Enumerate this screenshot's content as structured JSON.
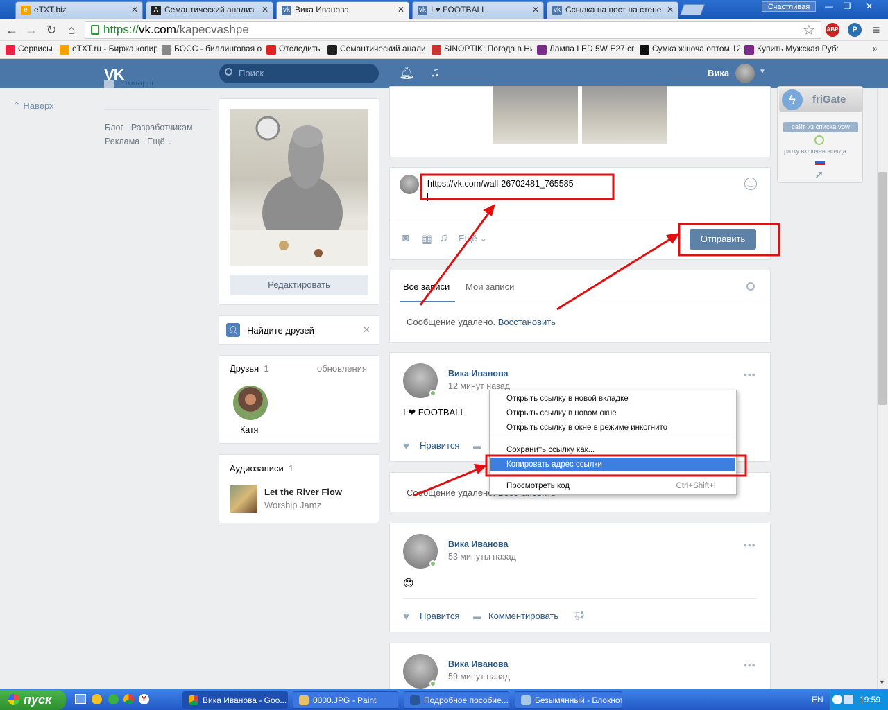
{
  "browser": {
    "tabs": [
      {
        "label": "eTXT.biz",
        "favicon": "etxt-favicon-icon",
        "color": "#f4a300"
      },
      {
        "label": "Семантический анализ тек",
        "favicon": "letter-a-icon",
        "color": "#222"
      },
      {
        "label": "Вика Иванова",
        "favicon": "vk-icon",
        "color": "#4a76a8",
        "active": true
      },
      {
        "label": "I ♥ FOOTBALL",
        "favicon": "vk-icon",
        "color": "#4a76a8"
      },
      {
        "label": "Ссылка на пост на стене в",
        "favicon": "vk-icon",
        "color": "#4a76a8"
      }
    ],
    "user_badge": "Счастливая",
    "url_scheme": "https://",
    "url_host": "vk.com",
    "url_path": "/kapecvashpe",
    "bookmarks": [
      {
        "label": "Сервисы",
        "icon": "apps-grid-icon",
        "color": "#e24"
      },
      {
        "label": "eTXT.ru - Биржа копир",
        "icon": "etxt-icon",
        "color": "#f4a300"
      },
      {
        "label": "БОСС - биллинговая он",
        "icon": "boss-icon",
        "color": "#888"
      },
      {
        "label": "Отследить",
        "icon": "track-icon",
        "color": "#d22"
      },
      {
        "label": "Семантический анализ",
        "icon": "letter-a-icon",
        "color": "#222"
      },
      {
        "label": "SINOPTIK: Погода в Ни",
        "icon": "thermometer-icon",
        "color": "#c33"
      },
      {
        "label": "Лампа LED 5W E27 свет",
        "icon": "shop-icon",
        "color": "#7b2d8e"
      },
      {
        "label": "Сумка жіноча оптом 12",
        "icon": "letter-t-icon",
        "color": "#111"
      },
      {
        "label": "Купить Мужская Рубаш",
        "icon": "shop-icon",
        "color": "#7b2d8e"
      }
    ]
  },
  "vk": {
    "header": {
      "logo": "VK",
      "search_placeholder": "Поиск",
      "user_name": "Вика"
    },
    "left_nav": {
      "back_up": "Наверх",
      "partial_item": "Товары",
      "links": [
        "Блог",
        "Разработчикам",
        "Реклама",
        "Ещё"
      ]
    },
    "profile": {
      "edit_button": "Редактировать",
      "find_friends": "Найдите друзей",
      "friends_title": "Друзья",
      "friends_count": "1",
      "friends_updates": "обновления",
      "friend_name": "Катя",
      "audio_title": "Аудиозаписи",
      "audio_count": "1",
      "audio_track": "Let the River Flow",
      "audio_artist": "Worship Jamz"
    },
    "composer": {
      "text": "https://vk.com/wall-26702481_765585",
      "more_label": "Ещё",
      "send_button": "Отправить"
    },
    "wall_tabs": {
      "all": "Все записи",
      "mine": "Мои записи"
    },
    "deleted_message": "Сообщение удалено.",
    "restore_link": "Восстановить",
    "posts": [
      {
        "author": "Вика Иванова",
        "time": "12 минут назад",
        "text": "I ❤ FOOTBALL",
        "like": "Нравится"
      },
      {
        "author": "Вика Иванова",
        "time": "53 минуты назад",
        "text": "😍",
        "like": "Нравится",
        "comment": "Комментировать"
      },
      {
        "author": "Вика Иванова",
        "time": "59 минут назад"
      }
    ]
  },
  "context_menu": {
    "items": [
      {
        "label": "Открыть ссылку в новой вкладке"
      },
      {
        "label": "Открыть ссылку в новом окне"
      },
      {
        "label": "Открыть ссылку в окне в режиме инкогнито"
      },
      {
        "label": "Сохранить ссылку как..."
      },
      {
        "label": "Копировать адрес ссылки",
        "selected": true
      },
      {
        "label": "Просмотреть код",
        "shortcut": "Ctrl+Shift+I"
      }
    ]
  },
  "frigate": {
    "title": "friGate",
    "site_badge": "сайт из списка vow",
    "proxy_status": "proxy включен всегда"
  },
  "taskbar": {
    "start": "пуск",
    "tasks": [
      {
        "label": "Вика Иванова - Goo...",
        "icon": "chrome-icon",
        "active": true
      },
      {
        "label": "0000.JPG - Paint",
        "icon": "paint-icon"
      },
      {
        "label": "Подробное пособие....",
        "icon": "word-icon"
      },
      {
        "label": "Безымянный - Блокнот",
        "icon": "notepad-icon"
      }
    ],
    "lang": "EN",
    "clock": "19:59"
  },
  "colors": {
    "vk_blue": "#4a76a8",
    "annotation_red": "#e01010",
    "menu_highlight": "#3d7fe0"
  }
}
